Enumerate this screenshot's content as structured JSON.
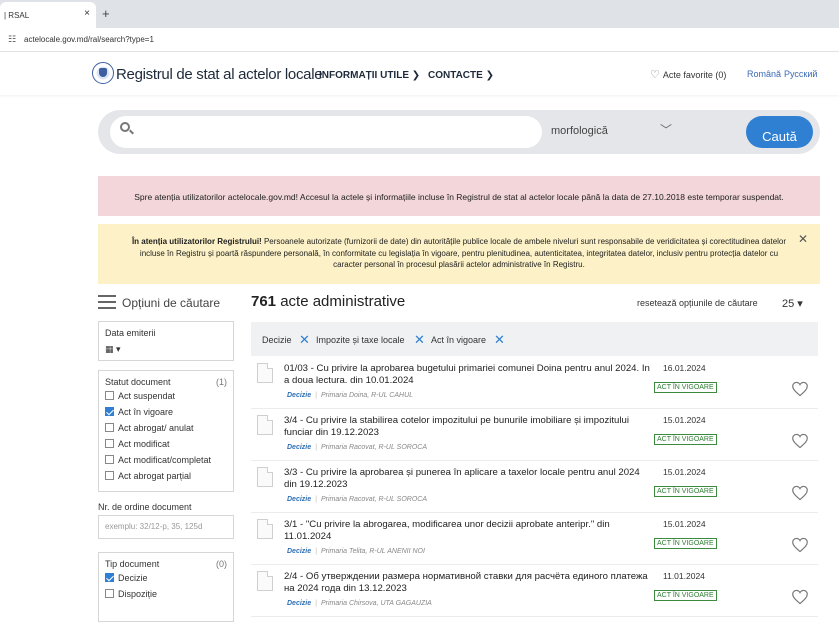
{
  "browser": {
    "tab_title": "| RSAL",
    "tab_close": "×",
    "new_tab": "+",
    "url": "actelocale.gov.md/ral/search?type=1"
  },
  "header": {
    "site_title": "Registrul de stat al actelor locale",
    "menu_info": "INFORMAȚII UTILE ❯",
    "menu_contact": "CONTACTE ❯",
    "favorites": "Acte favorite (0)",
    "lang_ro": "Română",
    "lang_ru": "Русский"
  },
  "search": {
    "placeholder": "",
    "mode": "morfologică",
    "button": "Caută"
  },
  "banners": {
    "red": "Spre atenția utilizatorilor actelocale.gov.md! Accesul la actele și informațiile incluse în Registrul de stat al actelor locale până la data de 27.10.2018 este temporar suspendat.",
    "yellow_bold": "În atenția utilizatorilor Registrului!",
    "yellow_text": " Persoanele autorizate (furnizorii de date) din autoritățile publice locale de ambele niveluri sunt responsabile de veridicitatea și corectitudinea datelor incluse în Registru și poartă răspundere personală, în conformitate cu legislația în vigoare, pentru plenitudinea, autenticitatea, integritatea datelor, inclusiv pentru protecția datelor cu caracter personal în procesul plasării actelor administrative în Registru.",
    "close": "✕"
  },
  "sidebar": {
    "title": "Opțiuni de căutare",
    "date_label": "Data emiterii",
    "date_icon": "▦ ▾",
    "status_label": "Statut document",
    "status_count": "(1)",
    "status_items": [
      {
        "label": "Act suspendat",
        "checked": false
      },
      {
        "label": "Act în vigoare",
        "checked": true
      },
      {
        "label": "Act abrogat/ anulat",
        "checked": false
      },
      {
        "label": "Act modificat",
        "checked": false
      },
      {
        "label": "Act modificat/completat",
        "checked": false
      },
      {
        "label": "Act abrogat parțial",
        "checked": false
      }
    ],
    "nr_label": "Nr. de ordine document",
    "nr_placeholder": "exemplu: 32/12-p, 35, 125d",
    "type_label": "Tip document",
    "type_count": "(0)",
    "type_items": [
      {
        "label": "Decizie",
        "checked": true
      },
      {
        "label": "Dispoziție",
        "checked": false
      }
    ]
  },
  "results": {
    "count": "761",
    "count_label": " acte administrative",
    "reset": "resetează opțiunile de căutare",
    "per_page": "25 ▾",
    "filters": [
      "Decizie",
      "Impozite și taxe locale",
      "Act în vigoare"
    ],
    "filter_x": "✕",
    "items": [
      {
        "title": "01/03 - Cu privire la aprobarea bugetului primariei comunei Doina pentru anul 2024. In a doua lectura. din 10.01.2024",
        "type": "Decizie",
        "authority": "Primaria Doina, R-UL CAHUL",
        "date": "16.01.2024",
        "status": "ACT ÎN VIGOARE"
      },
      {
        "title": "3/4 - Cu privire la stabilirea cotelor impozitului pe bunurile imobiliare și impozitului funciar din 19.12.2023",
        "type": "Decizie",
        "authority": "Primaria Racovat, R-UL SOROCA",
        "date": "15.01.2024",
        "status": "ACT ÎN VIGOARE"
      },
      {
        "title": "3/3 - Cu privire la aprobarea și punerea în aplicare a taxelor locale pentru anul 2024 din 19.12.2023",
        "type": "Decizie",
        "authority": "Primaria Racovat, R-UL SOROCA",
        "date": "15.01.2024",
        "status": "ACT ÎN VIGOARE"
      },
      {
        "title": "3/1 - \"Cu privire la abrogarea, modificarea unor decizii aprobate anteripr.\" din 11.01.2024",
        "type": "Decizie",
        "authority": "Primaria Telita, R-UL ANENII NOI",
        "date": "15.01.2024",
        "status": "ACT ÎN VIGOARE"
      },
      {
        "title": "2/4 - Об утверждении размера нормативной ставки для расчёта единого платежа на 2024 года din 13.12.2023",
        "type": "Decizie",
        "authority": "Primaria Chirsova, UTA GAGAUZIA",
        "date": "11.01.2024",
        "status": "ACT ÎN VIGOARE"
      }
    ]
  },
  "colors": {
    "accent": "#2f7fd3",
    "red_banner": "#f2d6d9",
    "yellow_banner": "#fdf2c7",
    "status_green": "#2e7d32"
  }
}
